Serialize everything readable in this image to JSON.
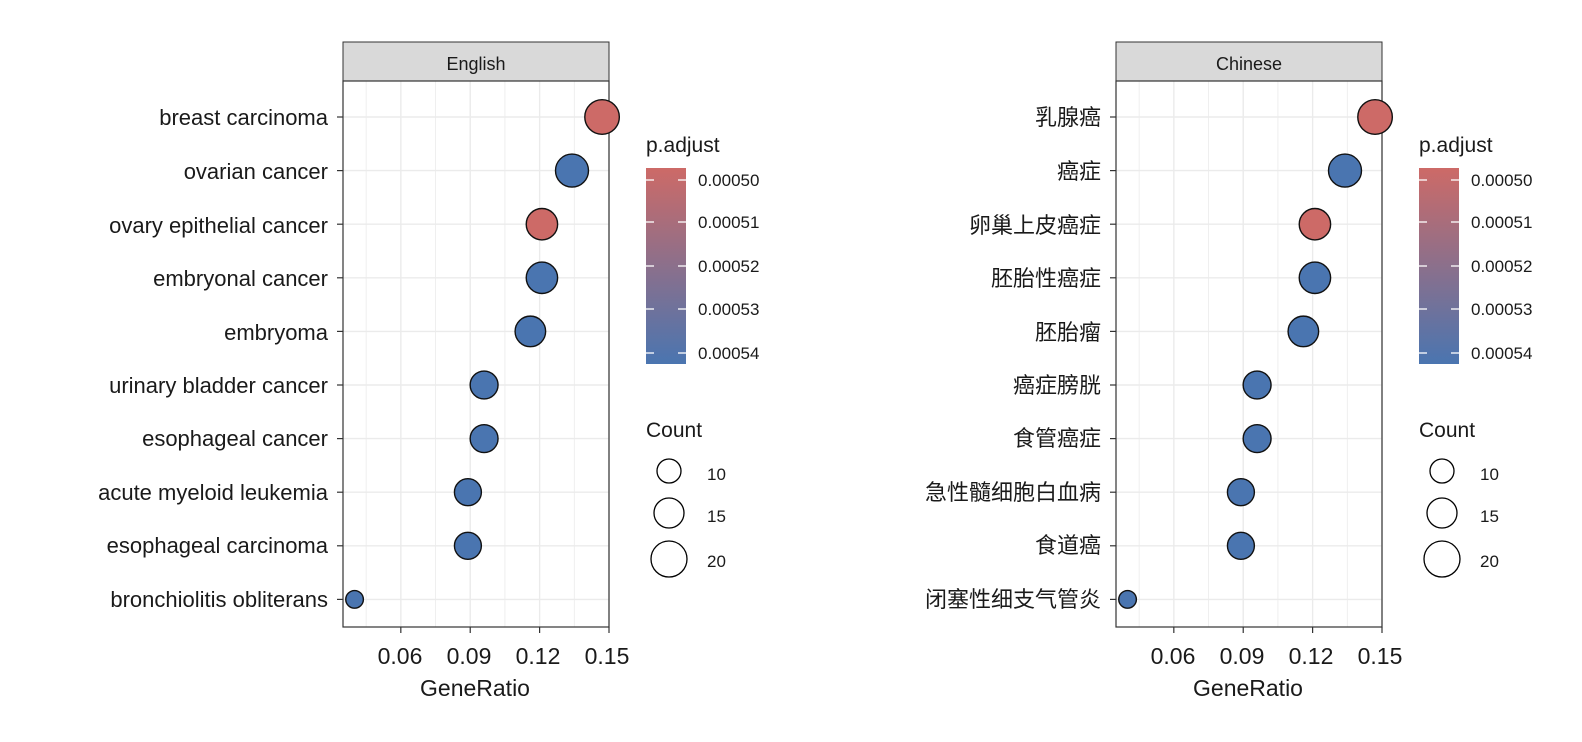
{
  "colors": {
    "low": "#cd6a67",
    "high": "#4a75b0",
    "strip": "#d9d9d9",
    "grid": "#ebebeb"
  },
  "chart_data": [
    {
      "type": "scatter",
      "strip_label": "English",
      "xlabel": "GeneRatio",
      "xlim": [
        0.035,
        0.15
      ],
      "x_ticks": [
        "0.06",
        "0.09",
        "0.12",
        "0.15"
      ],
      "grid": true,
      "categories": [
        "breast carcinoma",
        "ovarian cancer",
        "ovary epithelial cancer",
        "embryonal cancer",
        "embryoma",
        "urinary bladder cancer",
        "esophageal cancer",
        "acute myeloid leukemia",
        "esophageal carcinoma",
        "bronchiolitis obliterans"
      ],
      "x": [
        0.147,
        0.134,
        0.121,
        0.121,
        0.116,
        0.096,
        0.096,
        0.089,
        0.089,
        0.04
      ],
      "count": [
        23,
        21,
        19,
        19,
        18,
        15,
        15,
        14,
        14,
        6
      ],
      "p_adjust": [
        0.0005,
        0.00054,
        0.0005,
        0.00054,
        0.00054,
        0.00054,
        0.00054,
        0.00054,
        0.00054,
        0.00054
      ]
    },
    {
      "type": "scatter",
      "strip_label": "Chinese",
      "xlabel": "GeneRatio",
      "xlim": [
        0.035,
        0.15
      ],
      "x_ticks": [
        "0.06",
        "0.09",
        "0.12",
        "0.15"
      ],
      "grid": true,
      "categories": [
        "乳腺癌",
        "癌症",
        "卵巢上皮癌症",
        "胚胎性癌症",
        "胚胎瘤",
        "癌症膀胱",
        "食管癌症",
        "急性髓细胞白血病",
        "食道癌",
        "闭塞性细支气管炎"
      ],
      "x": [
        0.147,
        0.134,
        0.121,
        0.121,
        0.116,
        0.096,
        0.096,
        0.089,
        0.089,
        0.04
      ],
      "count": [
        23,
        21,
        19,
        19,
        18,
        15,
        15,
        14,
        14,
        6
      ],
      "p_adjust": [
        0.0005,
        0.00054,
        0.0005,
        0.00054,
        0.00054,
        0.00054,
        0.00054,
        0.00054,
        0.00054,
        0.00054
      ]
    }
  ],
  "legends": [
    {
      "color_title": "p.adjust",
      "color_labels": [
        "0.00050",
        "0.00051",
        "0.00052",
        "0.00053",
        "0.00054"
      ],
      "size_title": "Count",
      "size_labels": [
        "10",
        "15",
        "20"
      ]
    },
    {
      "color_title": "p.adjust",
      "color_labels": [
        "0.00050",
        "0.00051",
        "0.00052",
        "0.00053",
        "0.00054"
      ],
      "size_title": "Count",
      "size_labels": [
        "10",
        "15",
        "20"
      ]
    }
  ]
}
